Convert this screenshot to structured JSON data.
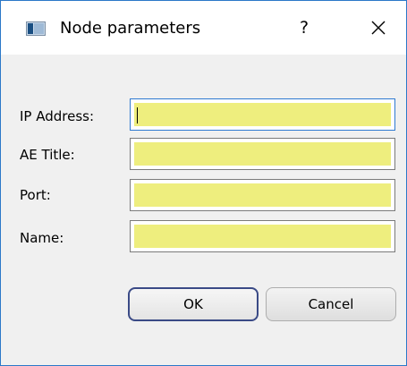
{
  "window": {
    "title": "Node parameters",
    "help_label": "?",
    "close_icon": "close-icon",
    "app_icon": "window-app-icon"
  },
  "form": {
    "fields": [
      {
        "label": "IP Address:",
        "value": "",
        "placeholder": ""
      },
      {
        "label": "AE Title:",
        "value": "",
        "placeholder": ""
      },
      {
        "label": "Port:",
        "value": "",
        "placeholder": ""
      },
      {
        "label": "Name:",
        "value": "",
        "placeholder": ""
      }
    ],
    "highlight_color": "#eeee7e",
    "focus_color": "#2f7ad1"
  },
  "buttons": {
    "ok_label": "OK",
    "cancel_label": "Cancel"
  }
}
